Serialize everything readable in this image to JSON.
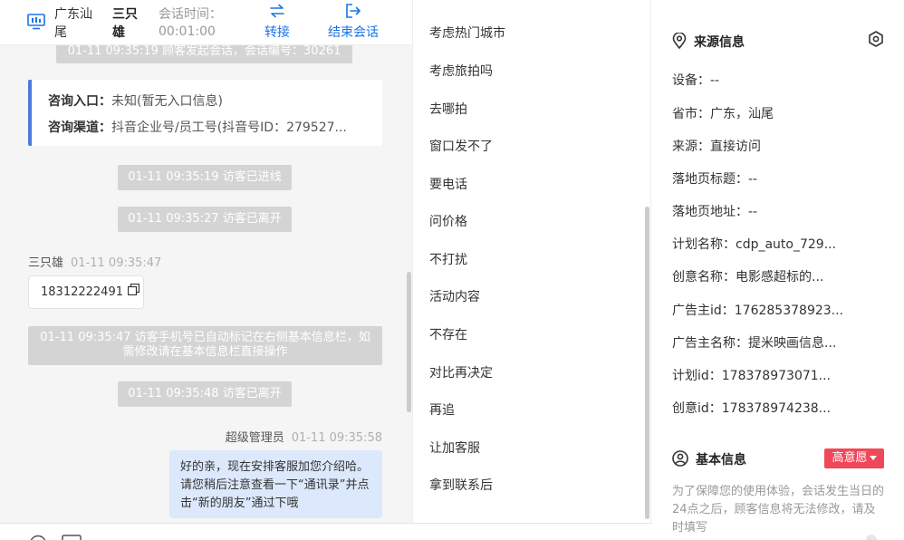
{
  "header": {
    "location": "广东汕尾",
    "visitor_name": "三只雄",
    "duration_label": "会话时间：",
    "duration_value": "00:01:00",
    "transfer_label": "转接",
    "end_label": "结束会话"
  },
  "messages": {
    "system_top": "01-11 09:35:19 顾客发起会话，会话编号：30261",
    "entry_label": "咨询入口：",
    "entry_value": "未知(暂无入口信息)",
    "channel_label": "咨询渠道：",
    "channel_value": "抖音企业号/员工号(抖音号ID：279527...",
    "sys_entered": "01-11 09:35:19 访客已进线",
    "sys_left_1": "01-11 09:35:27 访客已离开",
    "visitor_sender": "三只雄",
    "visitor_time": "01-11 09:35:47",
    "visitor_phone": "18312222491",
    "sys_phone_note": "01-11 09:35:47 访客手机号已自动标记在右侧基本信息栏，如需修改请在基本信息栏直接操作",
    "sys_left_2": "01-11 09:35:48 访客已离开",
    "agent_sender": "超级管理员",
    "agent_time": "01-11 09:35:58",
    "agent_text": "好的亲，现在安排客服加您介绍哈。请您稍后注意查看一下“通讯录”并点击“新的朋友”通过下哦"
  },
  "phrases": [
    "考虑热门城市",
    "考虑旅拍吗",
    "去哪拍",
    "窗口发不了",
    "要电话",
    "问价格",
    "不打扰",
    "活动内容",
    "不存在",
    "对比再决定",
    "再追",
    "让加客服",
    "拿到联系后"
  ],
  "source_info": {
    "title": "来源信息",
    "device": "设备：--",
    "province_city": "省市：广东，汕尾",
    "source": "来源：直接访问",
    "landing_title": "落地页标题：--",
    "landing_url": "落地页地址：--",
    "plan_name": "计划名称：cdp_auto_729...",
    "creative_name": "创意名称：电影感超标的...",
    "advertiser_id": "广告主id：176285378923...",
    "advertiser_name": "广告主名称：提米映画信息...",
    "plan_id": "计划id：178378973071...",
    "creative_id": "创意id：178378974238..."
  },
  "basic_info": {
    "title": "基本信息",
    "intent_badge": "高意愿",
    "notice": "为了保障您的使用体验，会话发生当日的24点之后，顾客信息将无法修改，请及时填写"
  },
  "colors": {
    "accent": "#1a73e8",
    "entry_border": "#4a7bd8",
    "agent_bubble": "#dce8fb",
    "intent_badge": "#f0485a"
  }
}
